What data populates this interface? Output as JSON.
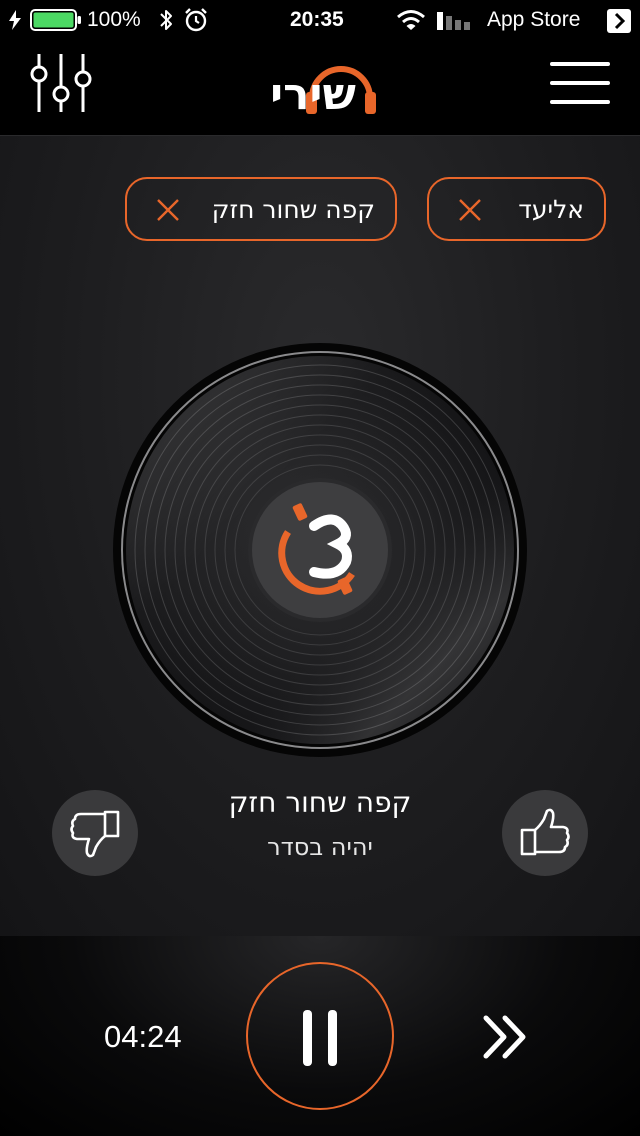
{
  "status_bar": {
    "battery_percent": "100%",
    "time": "20:35",
    "back_app": "App Store",
    "icons": [
      "charging-icon",
      "battery-icon",
      "bluetooth-icon",
      "alarm-icon",
      "wifi-icon",
      "signal-icon",
      "chevron-right-icon"
    ]
  },
  "header": {
    "logo": "שירי",
    "icons": [
      "equalizer-icon",
      "menu-icon"
    ]
  },
  "filters": [
    {
      "label": "קפה שחור חזק"
    },
    {
      "label": "אליעד"
    }
  ],
  "now_playing": {
    "title": "קפה שחור חזק",
    "artist": "יהיה בסדר"
  },
  "player": {
    "elapsed": "04:24"
  },
  "colors": {
    "accent": "#e8662a",
    "background": "#161618",
    "vote_button": "#3a3a3c"
  }
}
